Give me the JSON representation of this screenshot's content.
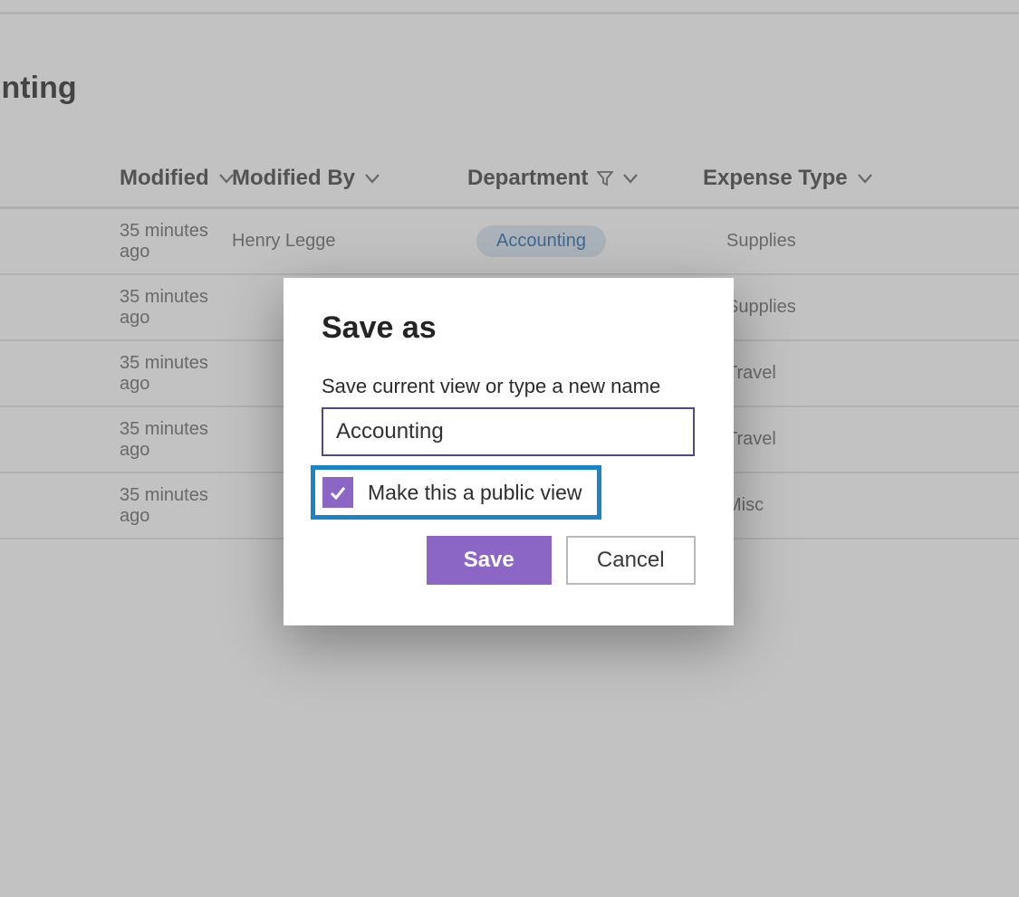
{
  "pageTitle": "ounting",
  "columns": {
    "modified": "Modified",
    "modifiedBy": "Modified By",
    "department": "Department",
    "expenseType": "Expense Type"
  },
  "rows": [
    {
      "modified": "35 minutes ago",
      "modifiedBy": "Henry Legge",
      "department": "Accounting",
      "expenseType": "Supplies"
    },
    {
      "modified": "35 minutes ago",
      "modifiedBy": "",
      "department": "",
      "expenseType": "Supplies"
    },
    {
      "modified": "35 minutes ago",
      "modifiedBy": "",
      "department": "",
      "expenseType": "Travel"
    },
    {
      "modified": "35 minutes ago",
      "modifiedBy": "",
      "department": "",
      "expenseType": "Travel"
    },
    {
      "modified": "35 minutes ago",
      "modifiedBy": "",
      "department": "",
      "expenseType": "Misc"
    }
  ],
  "dialog": {
    "title": "Save as",
    "label": "Save current view or type a new name",
    "value": "Accounting",
    "checkboxLabel": "Make this a public view",
    "save": "Save",
    "cancel": "Cancel"
  }
}
